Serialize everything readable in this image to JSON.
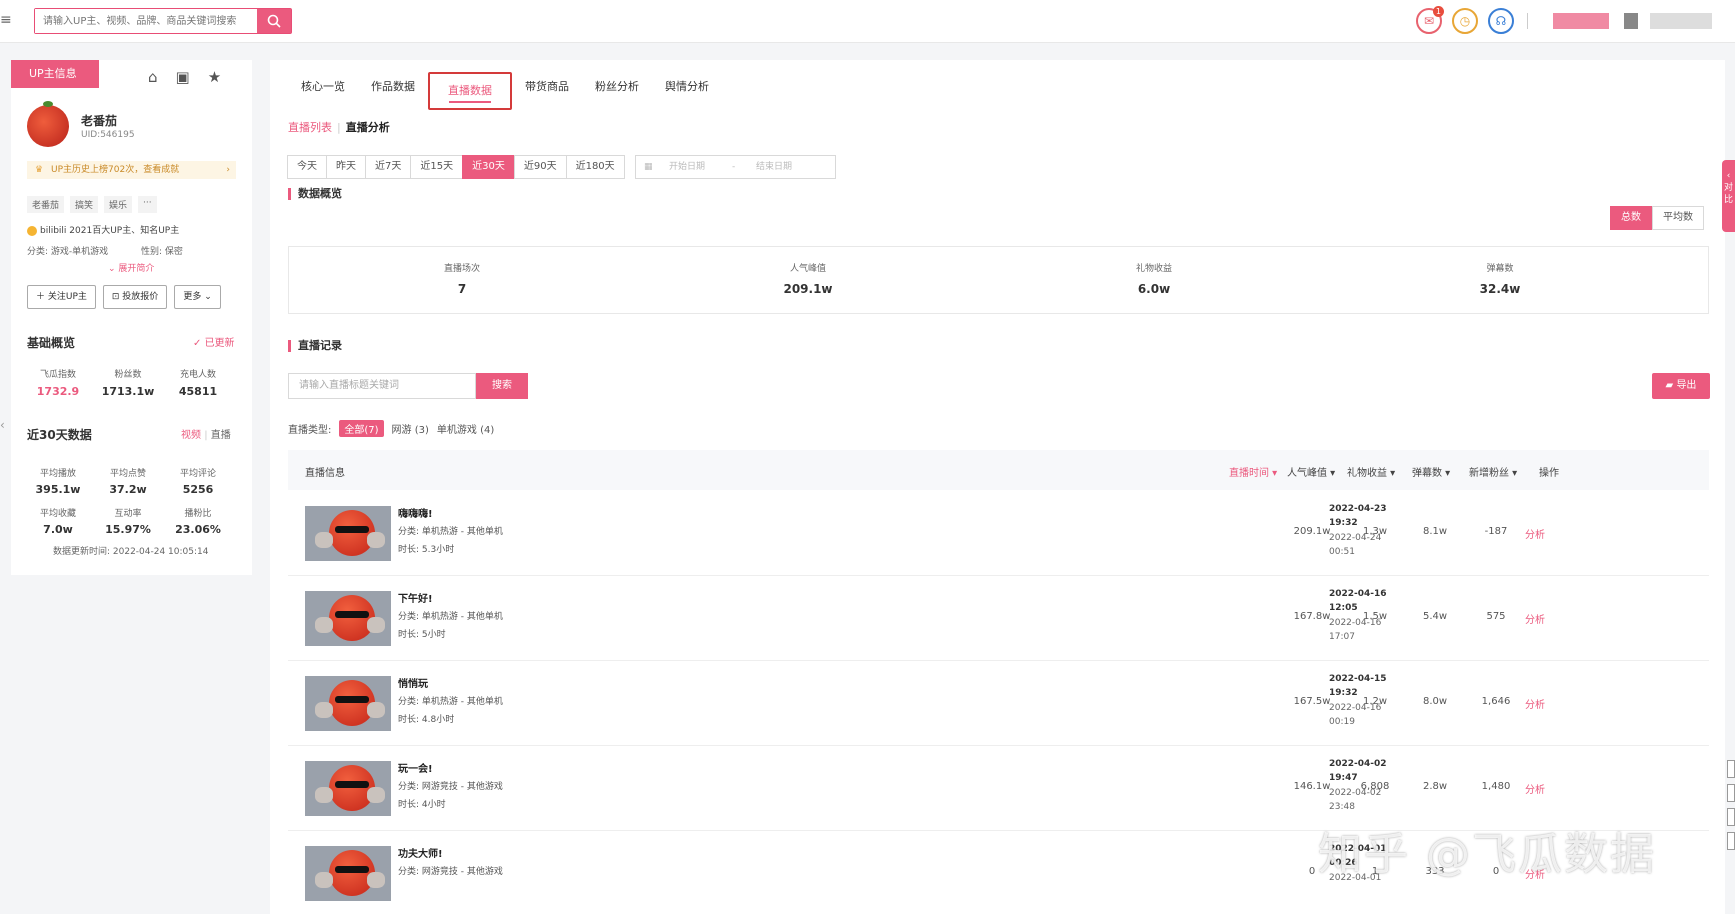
{
  "top": {
    "menu_icon": "≡",
    "search_placeholder": "请输入UP主、视频、品牌、商品关键词搜索",
    "msg_badge": "1"
  },
  "left": {
    "header_label": "UP主信息",
    "name": "老番茄",
    "uid": "UID:546195",
    "history": "UP主历史上榜702次，查看成就",
    "tags": [
      "老番茄",
      "搞笑",
      "娱乐",
      "···"
    ],
    "bili": "bilibili 2021百大UP主、知名UP主",
    "category": "分类: 游戏-单机游戏",
    "gender": "性别: 保密",
    "expand": "展开简介",
    "btn_follow": "关注UP主",
    "btn_quote": "投放报价",
    "btn_more": "更多",
    "basic_title": "基础概览",
    "updated": "已更新",
    "basic_stats": [
      {
        "label": "飞瓜指数",
        "value": "1732.9"
      },
      {
        "label": "粉丝数",
        "value": "1713.1w"
      },
      {
        "label": "充电人数",
        "value": "45811"
      }
    ],
    "recent_title": "近30天数据",
    "recent_tab_video": "视频",
    "recent_tab_sep": "|",
    "recent_tab_live": "直播",
    "recent_stats": [
      {
        "label": "平均播放",
        "value": "395.1w"
      },
      {
        "label": "平均点赞",
        "value": "37.2w"
      },
      {
        "label": "平均评论",
        "value": "5256"
      },
      {
        "label": "平均收藏",
        "value": "7.0w"
      },
      {
        "label": "互动率",
        "value": "15.97%"
      },
      {
        "label": "播粉比",
        "value": "23.06%"
      }
    ],
    "update_time": "数据更新时间:  2022-04-24 10:05:14"
  },
  "main": {
    "tabs": [
      "核心一览",
      "作品数据",
      "直播数据",
      "带货商品",
      "粉丝分析",
      "舆情分析"
    ],
    "crumb_list": "直播列表",
    "crumb_analysis": "直播分析",
    "date_buttons": [
      "今天",
      "昨天",
      "近7天",
      "近15天",
      "近30天",
      "近90天",
      "近180天"
    ],
    "date_start": "开始日期",
    "date_dash": "-",
    "date_end": "结束日期",
    "overview_title": "数据概览",
    "sum_total": "总数",
    "sum_avg": "平均数",
    "overview": [
      {
        "label": "直播场次",
        "value": "7"
      },
      {
        "label": "人气峰值",
        "value": "209.1w"
      },
      {
        "label": "礼物收益",
        "value": "6.0w"
      },
      {
        "label": "弹幕数",
        "value": "32.4w"
      }
    ],
    "records_title": "直播记录",
    "keyword_placeholder": "请输入直播标题关键词",
    "search_btn": "搜索",
    "export_btn": "导出",
    "type_label": "直播类型:",
    "types": [
      "全部(7)",
      "网游 (3)",
      "单机游戏 (4)"
    ],
    "columns": [
      "直播信息",
      "直播时间 ▾",
      "人气峰值 ▾",
      "礼物收益 ▾",
      "弹幕数 ▾",
      "新增粉丝 ▾",
      "操作"
    ],
    "rows": [
      {
        "title": "嗨嗨嗨!",
        "cat": "分类:  单机热游 - 其他单机",
        "dur": "时长:  5.3小时",
        "start_date": "2022-04-23",
        "start_time": "19:32",
        "end_date": "2022-04-24",
        "end_time": "00:51",
        "peak": "209.1w",
        "gift": "1.3w",
        "danmu": "8.1w",
        "fans": "-187",
        "action": "分析"
      },
      {
        "title": "下午好!",
        "cat": "分类:  单机热游 - 其他单机",
        "dur": "时长:  5小时",
        "start_date": "2022-04-16",
        "start_time": "12:05",
        "end_date": "2022-04-16",
        "end_time": "17:07",
        "peak": "167.8w",
        "gift": "1.5w",
        "danmu": "5.4w",
        "fans": "575",
        "action": "分析"
      },
      {
        "title": "悄悄玩",
        "cat": "分类:  单机热游 - 其他单机",
        "dur": "时长:  4.8小时",
        "start_date": "2022-04-15",
        "start_time": "19:32",
        "end_date": "2022-04-16",
        "end_time": "00:19",
        "peak": "167.5w",
        "gift": "1.2w",
        "danmu": "8.0w",
        "fans": "1,646",
        "action": "分析"
      },
      {
        "title": "玩一会!",
        "cat": "分类:  网游竞技 - 其他游戏",
        "dur": "时长:  4小时",
        "start_date": "2022-04-02",
        "start_time": "19:47",
        "end_date": "2022-04-02",
        "end_time": "23:48",
        "peak": "146.1w",
        "gift": "6,808",
        "danmu": "2.8w",
        "fans": "1,480",
        "action": "分析"
      },
      {
        "title": "功夫大师!",
        "cat": "分类:  网游竞技 - 其他游戏",
        "dur": "",
        "start_date": "2022-04-01",
        "start_time": "00:26",
        "end_date": "2022-04-01",
        "end_time": "",
        "peak": "0",
        "gift": "1",
        "danmu": "333",
        "fans": "0",
        "action": "分析"
      }
    ]
  },
  "side_tab": "对比",
  "watermark": "知乎 @飞瓜数据",
  "colors": {
    "accent": "#eb5a7e",
    "highlight_box": "#d43a3a"
  }
}
